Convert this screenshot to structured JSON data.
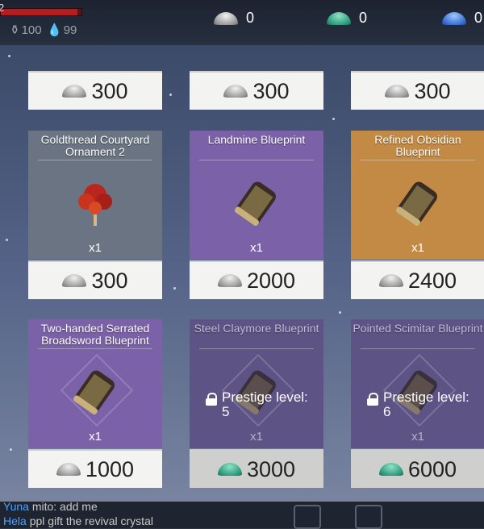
{
  "hud": {
    "level": "2",
    "hp_fraction": 0.95,
    "stat1": "100",
    "stat2": "99",
    "resources": [
      {
        "name": "silver",
        "value": "0",
        "icon": "silver-ore-icon"
      },
      {
        "name": "green",
        "value": "0",
        "icon": "green-crystal-icon"
      },
      {
        "name": "blue",
        "value": "0",
        "icon": "blue-crystal-icon"
      }
    ]
  },
  "top_prices": [
    "300",
    "300",
    "300"
  ],
  "cards": [
    {
      "title": "Goldthread Courtyard Ornament 2",
      "qty": "x1",
      "price": "300",
      "currency": "silver",
      "color": "grey",
      "icon": "red-tree-icon",
      "locked": false
    },
    {
      "title": "Landmine Blueprint",
      "qty": "x1",
      "price": "2000",
      "currency": "silver",
      "color": "purple",
      "icon": "blueprint-scroll-icon",
      "locked": false
    },
    {
      "title": "Refined Obsidian Blueprint",
      "qty": "x1",
      "price": "2400",
      "currency": "silver",
      "color": "orange",
      "icon": "blueprint-scroll-icon",
      "locked": false
    },
    {
      "title": "Two-handed Serrated Broadsword Blueprint",
      "qty": "x1",
      "price": "1000",
      "currency": "silver",
      "color": "purple",
      "icon": "blueprint-scroll-icon",
      "locked": false
    },
    {
      "title": "Steel Claymore Blueprint",
      "qty": "x1",
      "price": "3000",
      "currency": "green",
      "color": "dim",
      "icon": "blueprint-scroll-icon",
      "locked": true,
      "lock_text": "Prestige level:",
      "lock_level": "5"
    },
    {
      "title": "Pointed Scimitar Blueprint",
      "qty": "x1",
      "price": "6000",
      "currency": "green",
      "color": "dim",
      "icon": "blueprint-scroll-icon",
      "locked": true,
      "lock_text": "Prestige level:",
      "lock_level": "6"
    }
  ],
  "chat": [
    {
      "name": "Yuna",
      "text": "mito: add me"
    },
    {
      "name": "Hela",
      "text": "ppl gift the revival crystal"
    }
  ],
  "colors": {
    "grey": "#6a7482",
    "purple": "#7a61a8",
    "orange": "#c28a45",
    "dim": "#5d5485"
  }
}
